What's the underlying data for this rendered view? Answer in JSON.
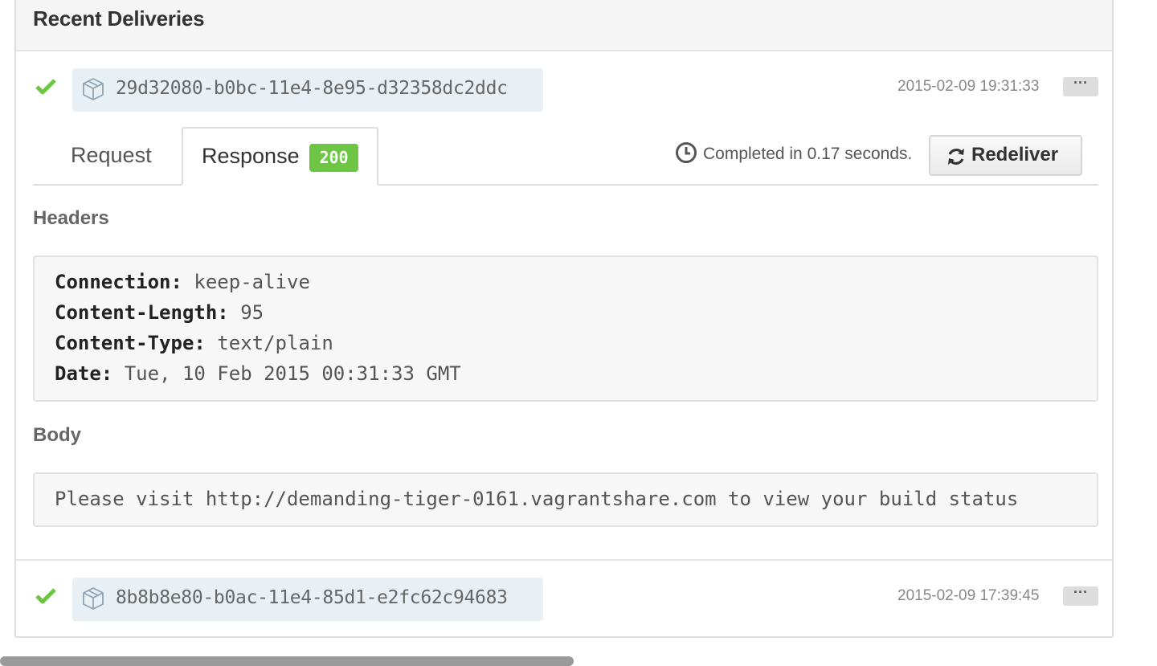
{
  "panel": {
    "title": "Recent Deliveries"
  },
  "deliveries": [
    {
      "status_icon": "check-icon",
      "guid": "29d32080-b0bc-11e4-8e95-d32358dc2ddc",
      "timestamp": "2015-02-09 19:31:33",
      "more_label": "···",
      "expanded": true
    },
    {
      "status_icon": "check-icon",
      "guid": "8b8b8e80-b0ac-11e4-85d1-e2fc62c94683",
      "timestamp": "2015-02-09 17:39:45",
      "more_label": "···",
      "expanded": false
    }
  ],
  "detail": {
    "tabs": [
      {
        "label": "Request",
        "active": false
      },
      {
        "label": "Response",
        "active": true,
        "badge": "200"
      }
    ],
    "completed_text": "Completed in 0.17 seconds.",
    "redeliver_label": "Redeliver",
    "headers_title": "Headers",
    "headers": [
      {
        "key": "Connection:",
        "value": " keep-alive"
      },
      {
        "key": "Content-Length:",
        "value": " 95"
      },
      {
        "key": "Content-Type:",
        "value": " text/plain"
      },
      {
        "key": "Date:",
        "value": " Tue, 10 Feb 2015 00:31:33 GMT"
      }
    ],
    "body_title": "Body",
    "body_text": "Please visit http://demanding-tiger-0161.vagrantshare.com to view your build status"
  },
  "colors": {
    "success": "#6cc644",
    "guid_bg": "#e8f0f5",
    "code_bg": "#f7f7f7"
  }
}
